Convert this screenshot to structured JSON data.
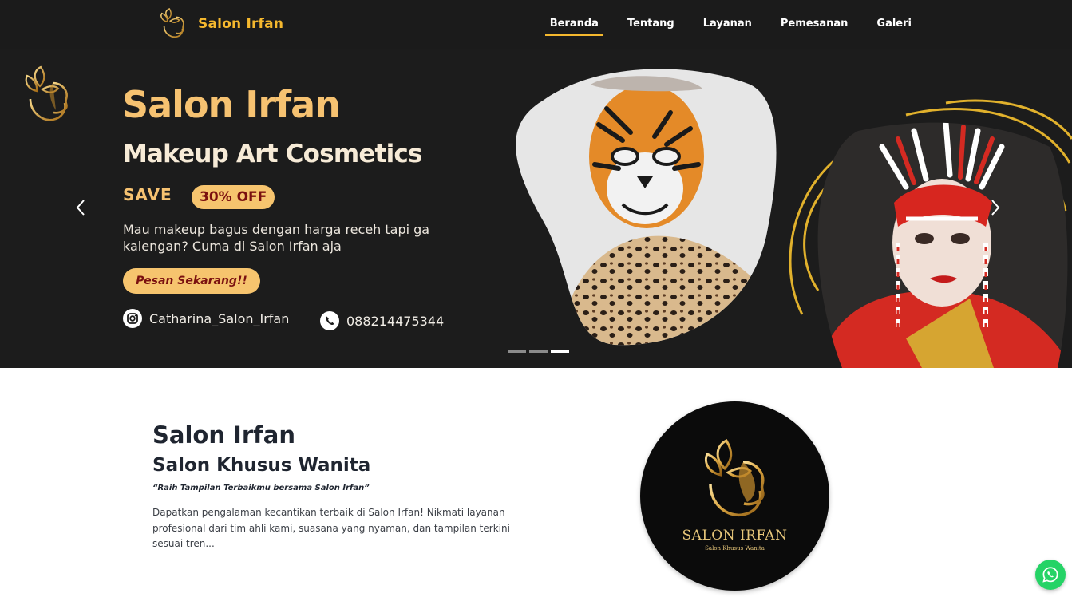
{
  "colors": {
    "accent": "#f5b82e",
    "hero_bg": "#1c1c1c",
    "navbar_bg": "#1b1b1b",
    "cta_bg": "#f6c46e",
    "whatsapp": "#25d366"
  },
  "navbar": {
    "brand_name": "Salon Irfan",
    "brand_icon": "salon-logo-icon",
    "items": [
      {
        "label": "Beranda",
        "active": true
      },
      {
        "label": "Tentang",
        "active": false
      },
      {
        "label": "Layanan",
        "active": false
      },
      {
        "label": "Pemesanan",
        "active": false
      },
      {
        "label": "Galeri",
        "active": false
      }
    ]
  },
  "hero": {
    "title": "Salon Irfan",
    "subtitle": "Makeup Art Cosmetics",
    "save_label": "SAVE",
    "discount_badge": "30% OFF",
    "description": "Mau makeup bagus dengan harga receh tapi ga kalengan? Cuma di Salon Irfan aja",
    "cta_label": "Pesan Sekarang!!",
    "instagram": "Catharina_Salon_Irfan",
    "phone": "088214475344",
    "carousel": {
      "slide_count": 3,
      "active_index": 2,
      "prev_icon": "chevron-left-icon",
      "next_icon": "chevron-right-icon"
    }
  },
  "about": {
    "title": "Salon Irfan",
    "subtitle": "Salon Khusus Wanita",
    "tagline": "“Raih Tampilan Terbaikmu bersama Salon Irfan”",
    "description": "Dapatkan pengalaman kecantikan terbaik di Salon Irfan! Nikmati layanan profesional dari tim ahli kami, suasana yang nyaman, dan tampilan terkini sesuai tren...",
    "logo_name": "SALON IRFAN",
    "logo_tagline": "Salon Khusus Wanita"
  },
  "whatsapp_icon": "whatsapp-icon"
}
